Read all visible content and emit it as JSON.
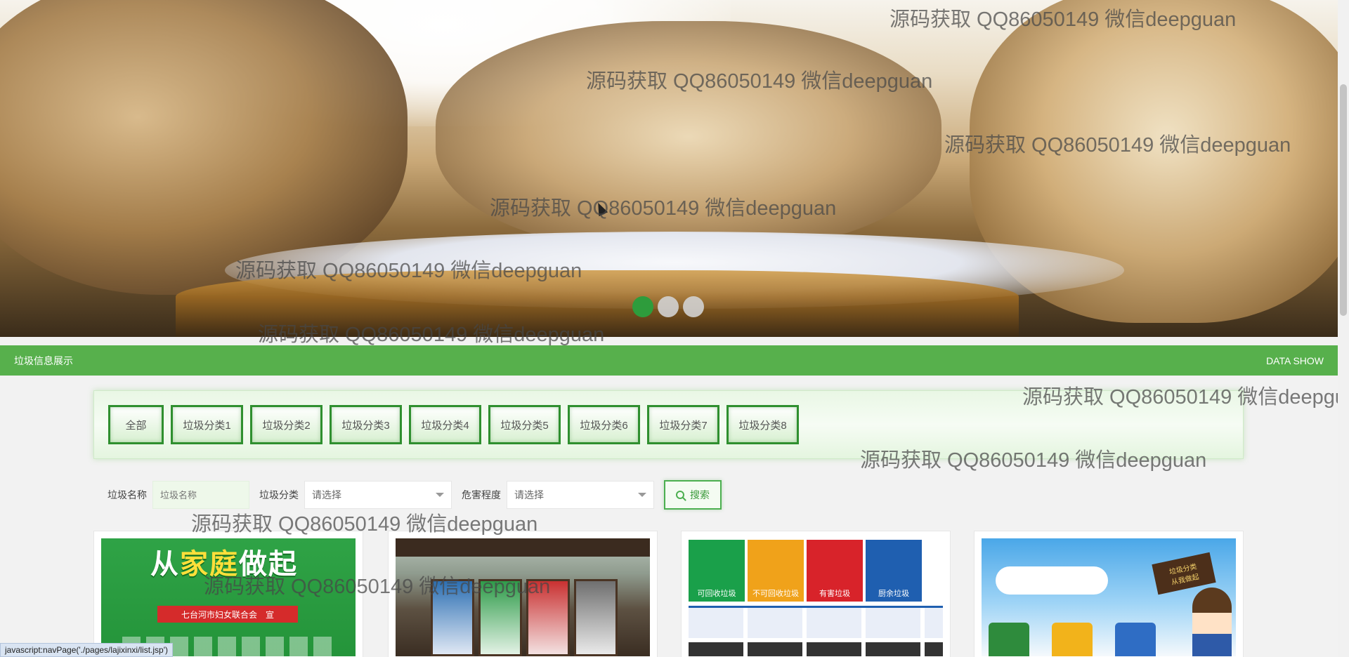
{
  "banner": {
    "slides": [
      {
        "active": true
      },
      {
        "active": false
      },
      {
        "active": false
      }
    ]
  },
  "section": {
    "title": "垃圾信息展示",
    "subtitle": "DATA SHOW"
  },
  "categories": [
    "全部",
    "垃圾分类1",
    "垃圾分类2",
    "垃圾分类3",
    "垃圾分类4",
    "垃圾分类5",
    "垃圾分类6",
    "垃圾分类7",
    "垃圾分类8"
  ],
  "search": {
    "name_label": "垃圾名称",
    "name_placeholder": "垃圾名称",
    "category_label": "垃圾分类",
    "category_value": "请选择",
    "danger_label": "危害程度",
    "danger_value": "请选择",
    "button_label": "搜索"
  },
  "cards": {
    "card1": {
      "headline_pre": "从",
      "headline_mid": "家庭",
      "headline_post": "做起",
      "ribbon": "七台河市妇女联合会　宣"
    },
    "card3": {
      "tiles": [
        "可回收垃圾",
        "不可回收垃圾",
        "有害垃圾",
        "厨余垃圾"
      ]
    },
    "card4": {
      "sign_line1": "垃圾分类",
      "sign_line2": "从我做起"
    }
  },
  "watermark": "源码获取 QQ86050149 微信deepguan",
  "status_bar": "javascript:navPage('./pages/lajixinxi/list.jsp')",
  "colors": {
    "accent": "#57b04c",
    "active_dot": "#2e9c3c",
    "button_border": "#2f8f2f"
  }
}
